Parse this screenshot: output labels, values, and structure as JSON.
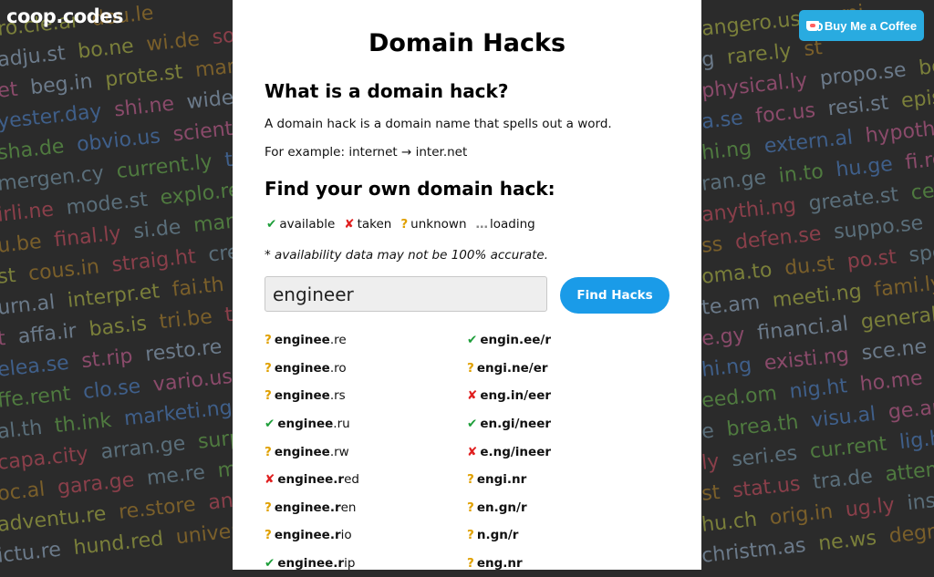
{
  "site": {
    "logo": "coop.codes",
    "coffee_label": "Buy Me a Coffee"
  },
  "page": {
    "title": "Domain Hacks",
    "what_heading": "What is a domain hack?",
    "what_text": "A domain hack is a domain name that spells out a word.",
    "example_text": "For example: internet → inter.net",
    "find_heading": "Find your own domain hack:",
    "legend": {
      "available": "available",
      "taken": "taken",
      "unknown": "unknown",
      "loading": "loading"
    },
    "note": "* availability data may not be 100% accurate.",
    "search_value": "engineer",
    "find_label": "Find Hacks"
  },
  "results_left": [
    {
      "status": "unknown",
      "bold": "enginee",
      "rest": ".re"
    },
    {
      "status": "unknown",
      "bold": "enginee",
      "rest": ".ro"
    },
    {
      "status": "unknown",
      "bold": "enginee",
      "rest": ".rs"
    },
    {
      "status": "available",
      "bold": "enginee",
      "rest": ".ru"
    },
    {
      "status": "unknown",
      "bold": "enginee",
      "rest": ".rw"
    },
    {
      "status": "taken",
      "bold": "enginee.r",
      "rest": "ed"
    },
    {
      "status": "unknown",
      "bold": "enginee.r",
      "rest": "en"
    },
    {
      "status": "unknown",
      "bold": "enginee.r",
      "rest": "io"
    },
    {
      "status": "available",
      "bold": "enginee.r",
      "rest": "ip"
    }
  ],
  "results_right": [
    {
      "status": "available",
      "bold": "engin.ee/r",
      "rest": ""
    },
    {
      "status": "unknown",
      "bold": "engi.ne/er",
      "rest": ""
    },
    {
      "status": "taken",
      "bold": "eng.in/eer",
      "rest": ""
    },
    {
      "status": "available",
      "bold": "en.gi/neer",
      "rest": ""
    },
    {
      "status": "taken",
      "bold": "e.ng/ineer",
      "rest": ""
    },
    {
      "status": "unknown",
      "bold": "engi.nr",
      "rest": ""
    },
    {
      "status": "unknown",
      "bold": "en.gn/r",
      "rest": ""
    },
    {
      "status": "unknown",
      "bold": "n.gn/r",
      "rest": ""
    },
    {
      "status": "unknown",
      "bold": "eng.nr",
      "rest": ""
    }
  ],
  "status_icons": {
    "available": "✔",
    "taken": "✘",
    "unknown": "?",
    "loading": "…"
  },
  "background_left": [
    [
      "ro.cle.ar",
      "dou.le"
    ],
    [
      "adju.st",
      "bo.ne",
      "wi.de",
      "soc"
    ],
    [
      "et",
      "beg.in",
      "prote.st",
      "marri"
    ],
    [
      "yester.day",
      "shi.ne",
      "wide.l"
    ],
    [
      "sha.de",
      "obvio.us",
      "scient."
    ],
    [
      "mergen.cy",
      "current.ly",
      "to.d"
    ],
    [
      "irli.ne",
      "mode.st",
      "explo.re"
    ],
    [
      "u.be",
      "final.ly",
      "si.de",
      "manu"
    ],
    [
      "st",
      "cous.in",
      "straig.ht",
      "creat"
    ],
    [
      "urn.al",
      "interpr.et",
      "fai.th",
      "yo"
    ],
    [
      "t",
      "affa.ir",
      "bas.is",
      "tri.be",
      "ton"
    ],
    [
      "elea.se",
      "st.rip",
      "resto.re",
      "pu"
    ],
    [
      "ffe.rent",
      "clo.se",
      "vario.us",
      "su"
    ],
    [
      "al.th",
      "th.ink",
      "marketi.ng",
      "e"
    ],
    [
      "capa.city",
      "arran.ge",
      "surpri"
    ],
    [
      "oc.al",
      "gara.ge",
      "me.re",
      "mov"
    ],
    [
      "adventu.re",
      "re.store",
      "anal"
    ],
    [
      "ictu.re",
      "hund.red",
      "univers"
    ]
  ],
  "background_right": [
    [
      "angero.us",
      "earni"
    ],
    [
      "g",
      "rare.ly",
      "st"
    ],
    [
      "physical.ly",
      "propo.se",
      "be"
    ],
    [
      "a.se",
      "foc.us",
      "resi.st",
      "episo.d"
    ],
    [
      "hi.ng",
      "extern.al",
      "hypothes"
    ],
    [
      "ran.ge",
      "in.to",
      "hu.ge",
      "fi.re",
      "s"
    ],
    [
      "anythi.ng",
      "greate.st",
      "ce"
    ],
    [
      "ss",
      "defen.se",
      "suppo.se",
      "ma"
    ],
    [
      "oma.to",
      "du.st",
      "po.st",
      "spec"
    ],
    [
      "te.am",
      "meeti.ng",
      "fami.ly"
    ],
    [
      "e.gy",
      "financi.al",
      "general.ly"
    ],
    [
      "hi.ng",
      "existi.ng",
      "sce.ne",
      "le"
    ],
    [
      "eed.om",
      "nig.ht",
      "ho.me",
      "e"
    ],
    [
      "e",
      "brea.th",
      "visu.al",
      "ge.ar",
      "s"
    ],
    [
      "ly",
      "seri.es",
      "cur.rent",
      "lig.ht"
    ],
    [
      "st",
      "stat.us",
      "tra.de",
      "attem.p"
    ],
    [
      "hu.ch",
      "orig.in",
      "ug.ly",
      "insi.de"
    ],
    [
      "christm.as",
      "ne.ws",
      "degr.e"
    ]
  ],
  "colors": {
    "palette": [
      "#7a7f3a",
      "#3f5f8a",
      "#8a3f4a",
      "#6b7a8a",
      "#4f7a3f",
      "#7a5f2a",
      "#8a4a6a",
      "#5a6e7a"
    ],
    "available": "#1e9e3a",
    "taken": "#e02020",
    "unknown": "#e0a000",
    "button": "#1a9be8",
    "coffee": "#29abe0"
  }
}
